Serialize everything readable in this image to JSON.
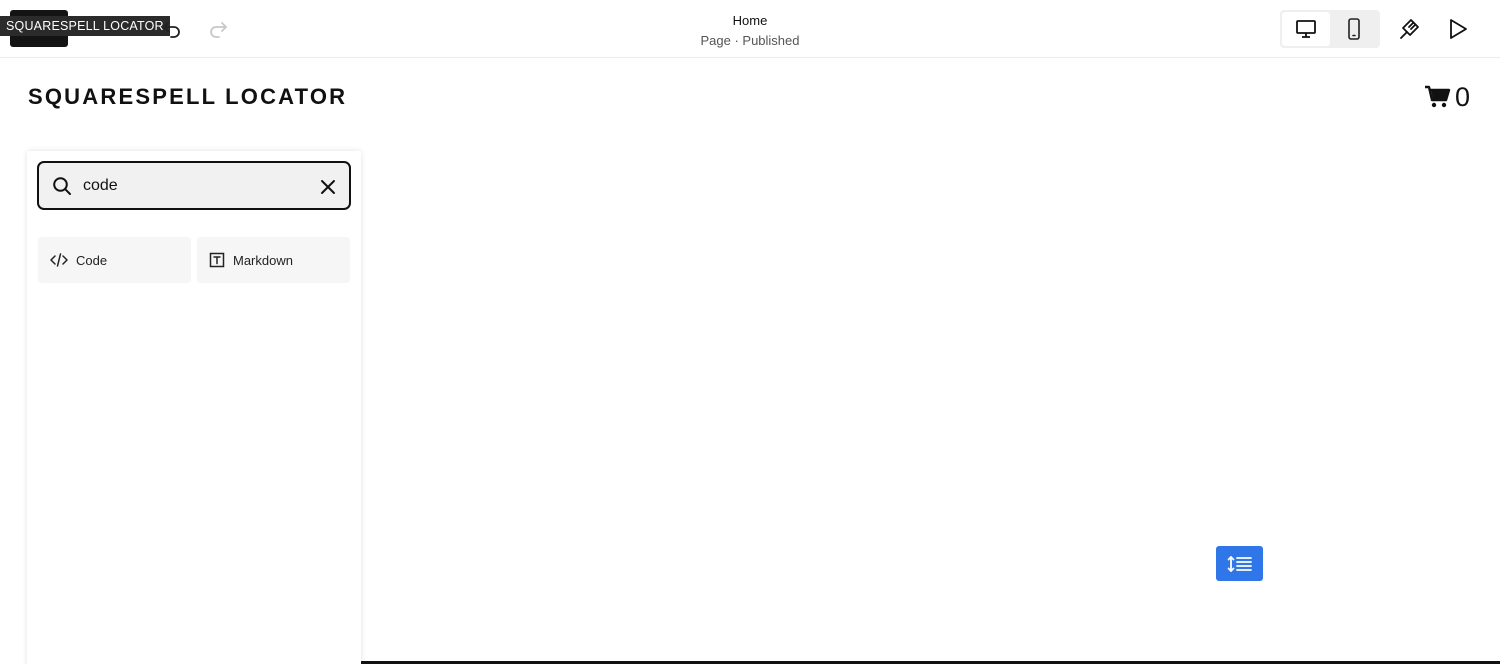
{
  "toolbar": {
    "tooltip": "SQUARESPELL LOCATOR",
    "page_title": "Home",
    "page_status": "Page · Published",
    "icons": {
      "undo": "undo-icon",
      "redo": "redo-icon",
      "desktop": "desktop-icon",
      "mobile": "mobile-icon",
      "design": "paintbrush-icon",
      "preview": "play-icon"
    }
  },
  "site": {
    "title": "SQUARESPELL LOCATOR",
    "cart_count": "0"
  },
  "block_picker": {
    "search_value": "code",
    "results": [
      {
        "label": "Code",
        "icon": "code-icon"
      },
      {
        "label": "Markdown",
        "icon": "markdown-icon"
      }
    ]
  },
  "colors": {
    "accent": "#2f76e8",
    "dark": "#141414"
  }
}
